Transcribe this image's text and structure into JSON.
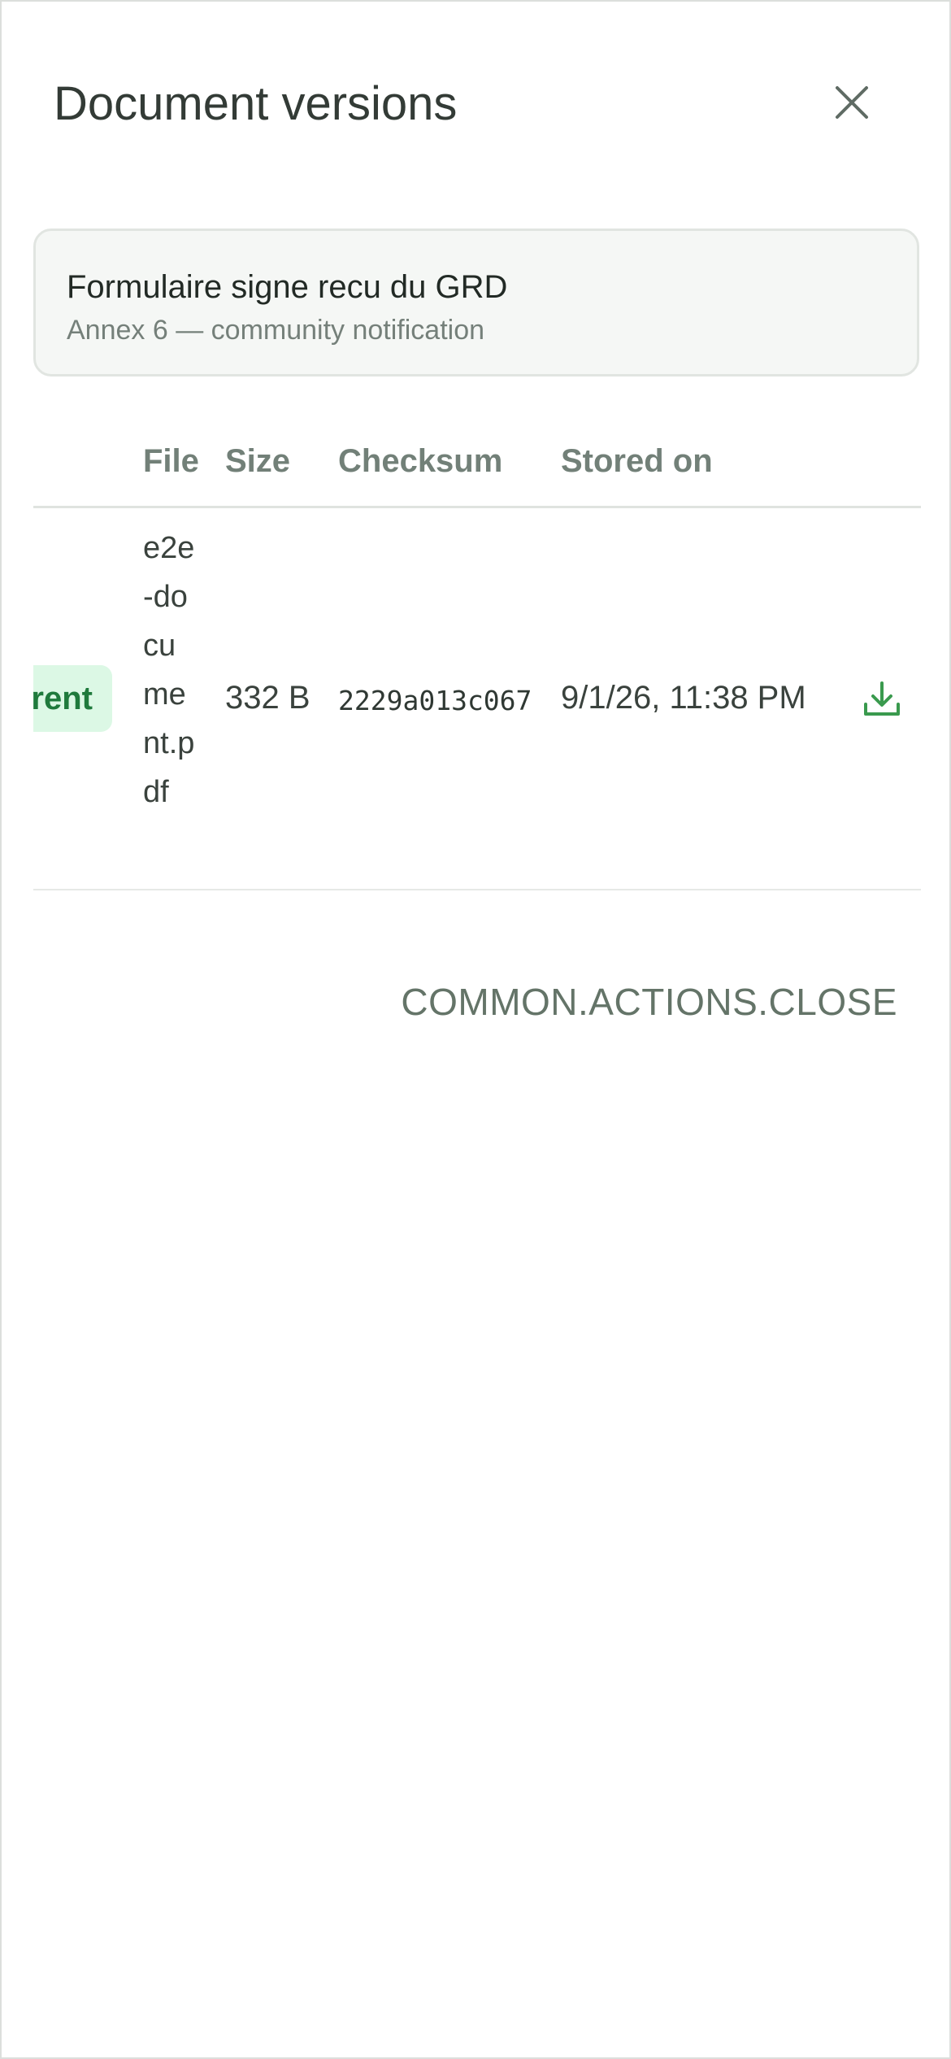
{
  "dialog": {
    "title": "Document versions",
    "close_icon": "close-icon"
  },
  "document": {
    "name": "Formulaire signe recu du GRD",
    "subtitle": "Annex 6 — community notification"
  },
  "table": {
    "columns": [
      "File",
      "Size",
      "Checksum",
      "Stored on"
    ],
    "rows": [
      {
        "status": "rent",
        "file": "e2e-document.pdf",
        "size": "332 B",
        "checksum": "2229a013c067",
        "stored_on": "9/1/26, 11:38 PM",
        "action_icon": "download-icon"
      }
    ]
  },
  "footer": {
    "close_label": "COMMON.ACTIONS.CLOSE"
  },
  "colors": {
    "accent": "#3a9a4e",
    "badge_bg": "#dcf8e5",
    "badge_text": "#1f7a3c",
    "muted_text": "#728078"
  }
}
